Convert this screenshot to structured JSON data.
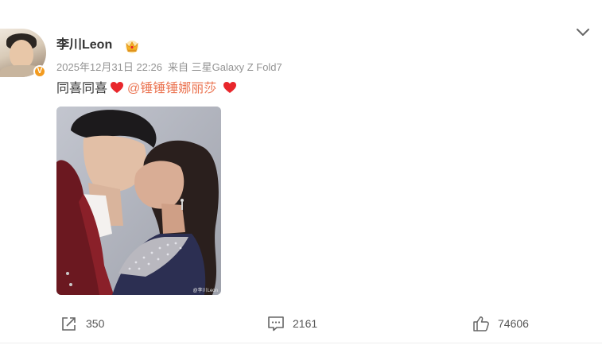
{
  "post": {
    "author": {
      "name": "李川Leon",
      "avatar_icon": "avatar-photo",
      "verified_badge": "V",
      "verified_color": "#f39b1f",
      "vip_icon": "crown-icon"
    },
    "timestamp": "2025年12月31日 22:26",
    "source_prefix": "来自",
    "source_device": "三星Galaxy Z Fold7",
    "text_prefix": "同喜同喜",
    "mention": "@锤锤锤娜丽莎",
    "mention_color": "#eb7350",
    "heart_color": "#e8262b",
    "image": {
      "watermark": "@李川Leon"
    }
  },
  "actions": {
    "repost_count": "350",
    "comment_count": "2161",
    "like_count": "74606"
  },
  "icons": {
    "menu": "chevron-down-icon",
    "repost": "share-icon",
    "comment": "comment-icon",
    "like": "thumbs-up-icon"
  }
}
